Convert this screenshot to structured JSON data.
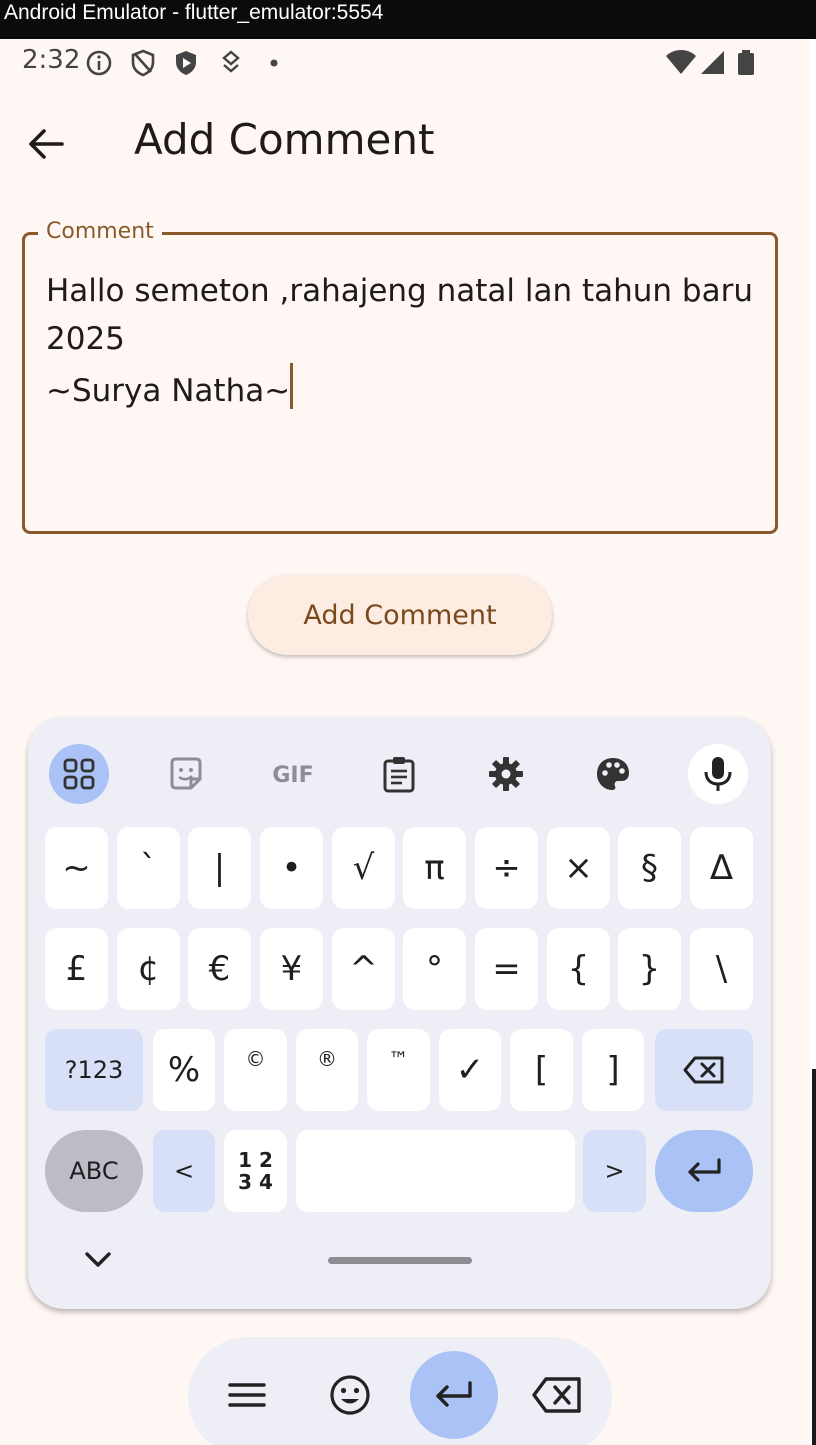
{
  "window": {
    "title": "Android Emulator - flutter_emulator:5554"
  },
  "status_bar": {
    "time": "2:32",
    "icons": [
      "info-icon",
      "shield-off-icon",
      "shield-play-icon",
      "download-icon",
      "dot-icon",
      "wifi-icon",
      "signal-icon",
      "battery-icon"
    ]
  },
  "app_bar": {
    "title": "Add Comment",
    "back_icon": "arrow-back-icon"
  },
  "comment_field": {
    "label": "Comment",
    "value": "Hallo semeton ,rahajeng natal lan tahun baru 2025\n~Surya Natha~"
  },
  "add_button": {
    "label": "Add Comment"
  },
  "keyboard": {
    "toolbar": [
      "apps-grid-icon",
      "sticker-icon",
      "gif-icon",
      "clipboard-icon",
      "gear-icon",
      "palette-icon",
      "mic-icon"
    ],
    "row1": [
      "~",
      "`",
      "|",
      "•",
      "√",
      "π",
      "÷",
      "×",
      "§",
      "Δ"
    ],
    "row2": [
      "£",
      "¢",
      "€",
      "¥",
      "^",
      "°",
      "=",
      "{",
      "}",
      "\\"
    ],
    "row3": {
      "mode": "?123",
      "keys": [
        "%",
        "©",
        "®",
        "™",
        "✓",
        "[",
        "]"
      ],
      "backspace_icon": "backspace-icon"
    },
    "row4": {
      "abc": "ABC",
      "lt": "<",
      "numpad_top": "1 2",
      "numpad_bottom": "3 4",
      "gt": ">",
      "enter_icon": "enter-icon"
    },
    "collapse_icon": "chevron-down-icon"
  },
  "nav_pill": [
    "menu-icon",
    "emoji-icon",
    "enter-icon",
    "backspace-icon"
  ],
  "colors": {
    "accent": "#8a5a2b",
    "button_bg": "#fcece2",
    "key_blue": "#aac2f5",
    "screen_bg": "#fff7f3"
  }
}
